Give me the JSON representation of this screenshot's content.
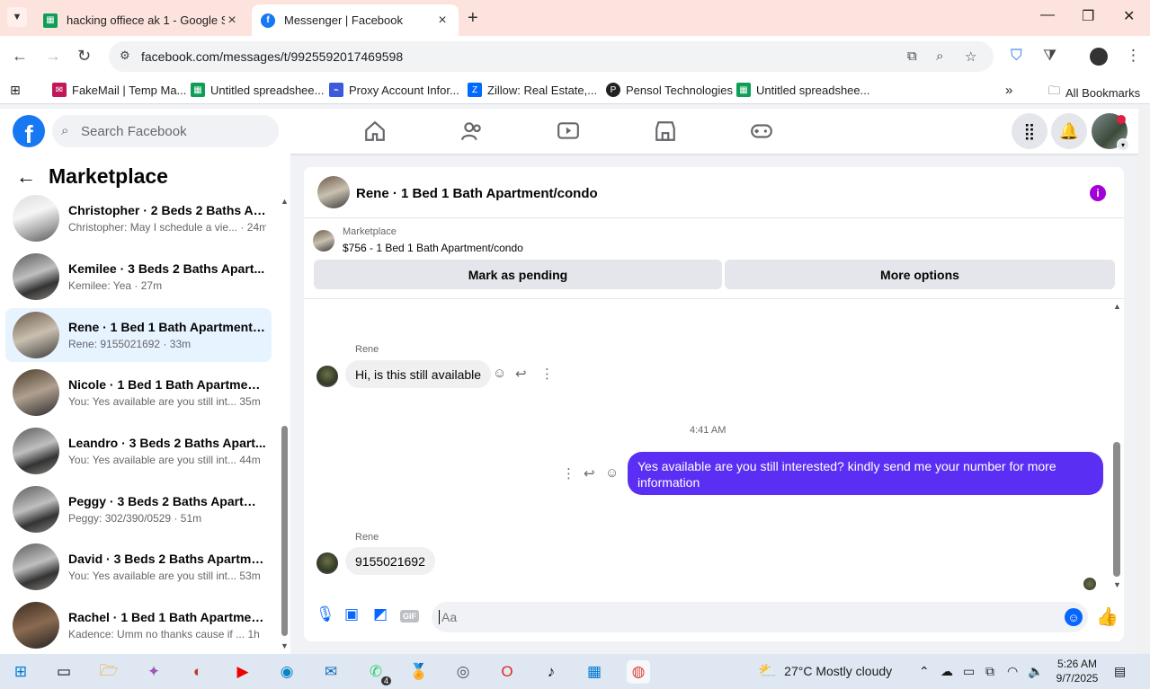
{
  "browser": {
    "tabs": [
      {
        "title": "hacking offiece ak 1 - Google Sh",
        "active": false,
        "favicon": "sheets-icon"
      },
      {
        "title": "Messenger | Facebook",
        "active": true,
        "favicon": "facebook-icon"
      }
    ],
    "url": "facebook.com/messages/t/9925592017469598",
    "bookmarks": [
      {
        "label": "FakeMail | Temp Ma...",
        "icon": "fakemail-icon"
      },
      {
        "label": "Untitled spreadshee...",
        "icon": "sheets-icon"
      },
      {
        "label": "Proxy Account Infor...",
        "icon": "proxy-icon"
      },
      {
        "label": "Zillow: Real Estate,...",
        "icon": "zillow-icon"
      },
      {
        "label": "Pensol Technologies",
        "icon": "pensol-icon"
      },
      {
        "label": "Untitled spreadshee...",
        "icon": "sheets-icon"
      }
    ],
    "all_bookmarks": "All Bookmarks"
  },
  "facebook": {
    "search_placeholder": "Search Facebook",
    "nav": [
      "home-icon",
      "friends-icon",
      "video-icon",
      "marketplace-icon",
      "gaming-icon"
    ],
    "accent": "#1877f2"
  },
  "sidebar": {
    "title": "Marketplace",
    "conversations": [
      {
        "name": "Christopher · 2 Beds 2 Baths Ap...",
        "preview": "Christopher: May I schedule a vie...",
        "time": "24m",
        "selected": false
      },
      {
        "name": "Kemilee · 3 Beds 2 Baths Apart...",
        "preview": "Kemilee: Yea",
        "time": "27m",
        "selected": false
      },
      {
        "name": "Rene · 1 Bed 1 Bath Apartment/c...",
        "preview": "Rene: 9155021692",
        "time": "33m",
        "selected": true
      },
      {
        "name": "Nicole · 1 Bed 1 Bath Apartment...",
        "preview": "You: Yes available are you still int...",
        "time": "35m",
        "selected": false
      },
      {
        "name": "Leandro · 3 Beds 2 Baths Apart...",
        "preview": "You: Yes available are you still int...",
        "time": "44m",
        "selected": false
      },
      {
        "name": "Peggy · 3 Beds 2 Baths Apartme...",
        "preview": "Peggy: 302/390/0529",
        "time": "51m",
        "selected": false
      },
      {
        "name": "David · 3 Beds 2 Baths Apartme...",
        "preview": "You: Yes available are you still int...",
        "time": "53m",
        "selected": false
      },
      {
        "name": "Rachel · 1 Bed 1 Bath Apartment...",
        "preview": "Kadence: Umm no thanks cause if ...",
        "time": "1h",
        "selected": false
      }
    ]
  },
  "chat": {
    "title": "Rene · 1 Bed 1 Bath Apartment/condo",
    "listing_source": "Marketplace",
    "listing_price": "$756 - 1 Bed 1 Bath Apartment/condo",
    "btn_pending": "Mark as pending",
    "btn_more": "More options",
    "messages": [
      {
        "sender": "Rene",
        "text": "Hi, is this still available",
        "direction": "in"
      },
      {
        "timestamp": "4:41 AM"
      },
      {
        "text": "Yes available are you still interested? kindly send me your number for more information",
        "direction": "out"
      },
      {
        "sender": "Rene",
        "text": "9155021692",
        "direction": "in"
      }
    ],
    "composer_placeholder": "Aa",
    "outgoing_color": "#5b2ff3"
  },
  "taskbar": {
    "weather": "27°C  Mostly cloudy",
    "time": "5:26 AM",
    "date": "9/7/2025",
    "whatsapp_badge": "4"
  }
}
